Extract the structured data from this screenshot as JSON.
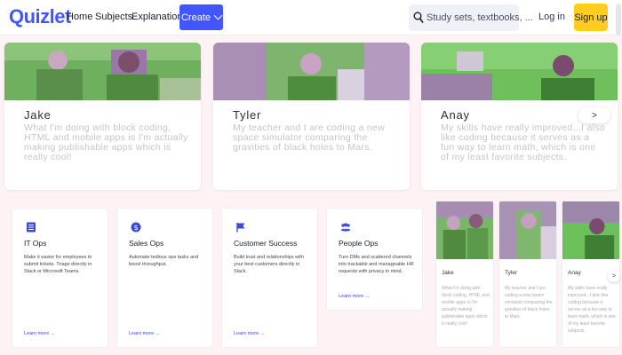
{
  "header": {
    "logo": "Quizlet",
    "nav": [
      "Home",
      "Subjects",
      "Explanations"
    ],
    "create_label": "Create",
    "search_placeholder": "Study sets, textbooks, ...",
    "login_label": "Log in",
    "signup_label": "Sign up"
  },
  "testimonials": [
    {
      "name": "Jake",
      "quote": "What I'm doing with block coding, HTML and mobile apps is I'm actually making publishable apps which is really cool!"
    },
    {
      "name": "Tyler",
      "quote": "My teacher and I are coding a new space simulator comparing the gravities of black holes to Mars."
    },
    {
      "name": "Anay",
      "quote": "My skills have really improved...I also like coding because it serves as a fun way to learn math, which is one of my least favorite subjects."
    }
  ],
  "next_label": ">",
  "ops_cards": [
    {
      "title": "IT Ops",
      "desc": "Make it easier for employees to submit tickets. Triage directly in Slack or Microsoft Teams.",
      "link": "Learn more →",
      "icon": "list-icon"
    },
    {
      "title": "Sales Ops",
      "desc": "Automate tedious ops tasks and boost throughput.",
      "link": "Learn more →",
      "icon": "dollar-icon"
    },
    {
      "title": "Customer Success",
      "desc": "Build trust and relationships with your best customers directly in Slack.",
      "link": "Learn more →",
      "icon": "flag-icon"
    },
    {
      "title": "People Ops",
      "desc": "Turn DMs and scattered channels into trackable and manageable HR requests with privacy in mind.",
      "link": "Learn more →",
      "icon": "people-icon"
    }
  ],
  "mini_testimonials": [
    {
      "name": "Jake",
      "quote": "What I'm doing with block coding, HTML and mobile apps is I'm actually making publishable apps which is really cool!"
    },
    {
      "name": "Tyler",
      "quote": "My teacher and I are coding a new space simulator comparing the gravities of black holes to Mars."
    },
    {
      "name": "Anay",
      "quote": "My skills have really improved...I also like coding because it serves as a fun way to learn math, which is one of my least favorite subjects."
    }
  ],
  "mini_next_label": ">",
  "colors": {
    "brand": "#4255ff",
    "signup": "#ffcd1f",
    "photo_tint": "#6fd66a",
    "link": "#3b4ad9"
  }
}
